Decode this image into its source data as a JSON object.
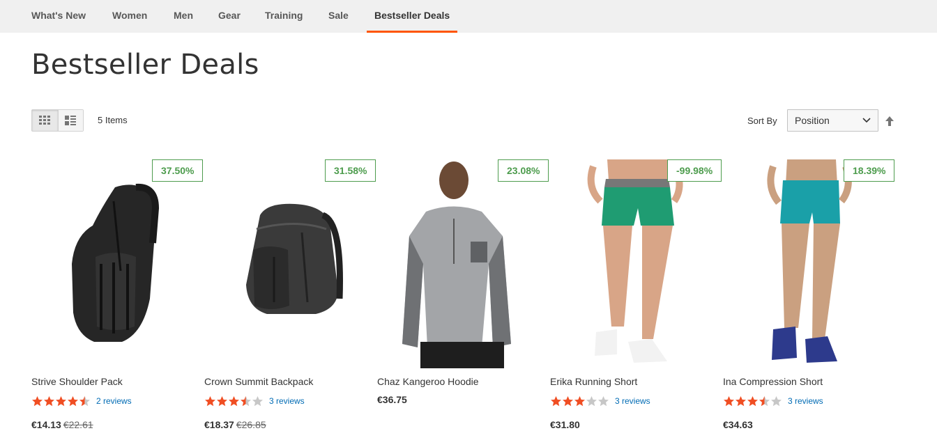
{
  "nav": {
    "items": [
      {
        "label": "What's New"
      },
      {
        "label": "Women"
      },
      {
        "label": "Men"
      },
      {
        "label": "Gear"
      },
      {
        "label": "Training"
      },
      {
        "label": "Sale"
      },
      {
        "label": "Bestseller Deals",
        "active": true
      }
    ]
  },
  "page": {
    "title": "Bestseller Deals"
  },
  "toolbar": {
    "view_modes": [
      "grid",
      "list"
    ],
    "active_view": "grid",
    "items_count": "5 Items",
    "sort_label": "Sort By",
    "sort_value": "Position",
    "sort_direction": "ascending"
  },
  "colors": {
    "accent": "#ff5501",
    "badge": "#4d9c4d",
    "star": "#f04e23",
    "star_empty": "#c7c7c7",
    "link": "#006bb4"
  },
  "products": [
    {
      "name": "Strive Shoulder Pack",
      "badge": "37.50%",
      "rating_stars": 4.5,
      "reviews": "2 reviews",
      "price": "€14.13",
      "old_price": "€22.61",
      "image": "sling-backpack"
    },
    {
      "name": "Crown Summit Backpack",
      "badge": "31.58%",
      "rating_stars": 3.5,
      "reviews": "3 reviews",
      "price": "€18.37",
      "old_price": "€26.85",
      "image": "backpack"
    },
    {
      "name": "Chaz Kangeroo Hoodie",
      "badge": "23.08%",
      "rating_stars": null,
      "reviews": "",
      "price": "€36.75",
      "old_price": "",
      "image": "hoodie-model"
    },
    {
      "name": "Erika Running Short",
      "badge": "-99.98%",
      "rating_stars": 3,
      "reviews": "3 reviews",
      "price": "€31.80",
      "old_price": "",
      "image": "green-shorts-model"
    },
    {
      "name": "Ina Compression Short",
      "badge": "18.39%",
      "rating_stars": 3.5,
      "reviews": "3 reviews",
      "price": "€34.63",
      "old_price": "",
      "image": "teal-shorts-model"
    }
  ]
}
